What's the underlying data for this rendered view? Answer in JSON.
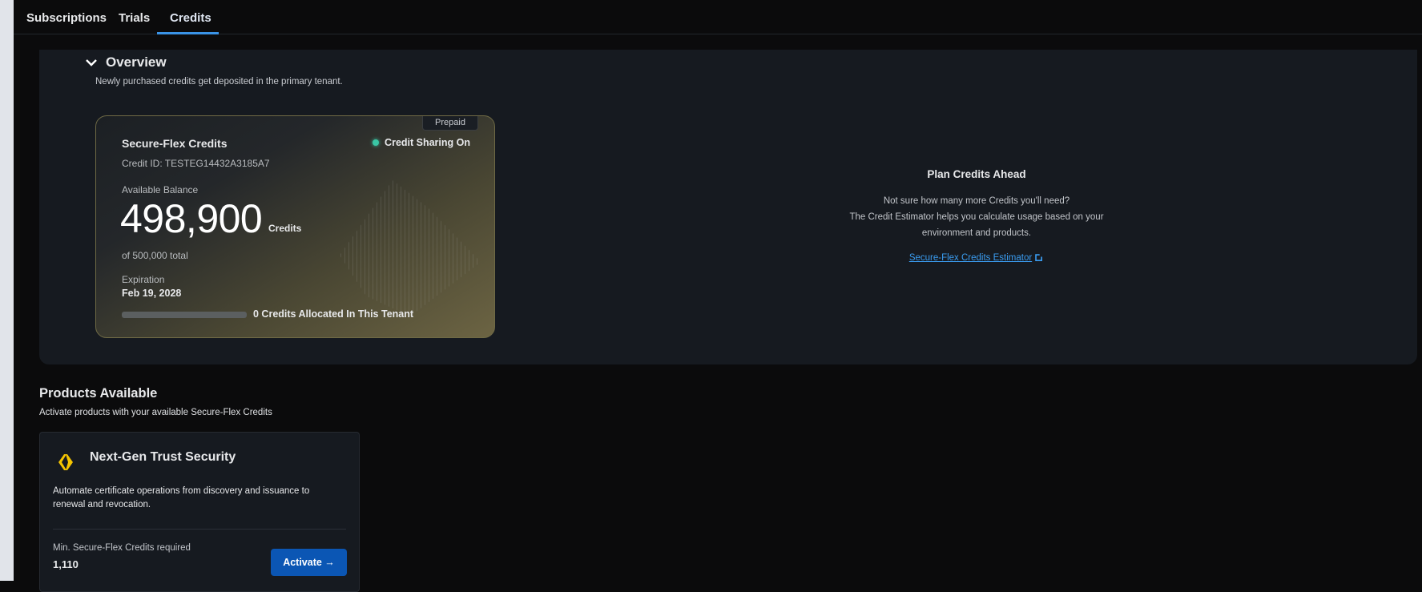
{
  "tabs": [
    {
      "label": "Subscriptions"
    },
    {
      "label": "Trials"
    },
    {
      "label": "Credits"
    }
  ],
  "overview": {
    "title": "Overview",
    "subtitle": "Newly purchased credits get deposited in the primary tenant."
  },
  "credit_card": {
    "badge": "Prepaid",
    "title": "Secure-Flex Credits",
    "sharing": "Credit Sharing On",
    "credit_id": "Credit ID: TESTEG14432A3185A7",
    "available_label": "Available Balance",
    "balance": "498,900",
    "unit": "Credits",
    "total": "of 500,000 total",
    "expiration_label": "Expiration",
    "expiration": "Feb 19, 2028",
    "allocated_fraction": 0,
    "allocated": "0 Credits Allocated In This Tenant"
  },
  "plan": {
    "title": "Plan Credits Ahead",
    "line1": "Not sure how many more Credits you'll need?",
    "line2": "The Credit Estimator helps you calculate usage based on your environment and products.",
    "link": "Secure-Flex Credits Estimator"
  },
  "products": {
    "title": "Products Available",
    "subtitle": "Activate products with your available Secure-Flex Credits",
    "items": [
      {
        "name": "Next-Gen Trust Security",
        "description": "Automate certificate operations from discovery and issuance to renewal and revocation.",
        "min_label": "Min. Secure-Flex Credits required",
        "min_value": "1,110",
        "button": "Activate →"
      }
    ]
  },
  "colors": {
    "accent": "#3a93e6",
    "button": "#0b56b4",
    "status": "#3ac7a5",
    "logo": "#f5c400"
  }
}
